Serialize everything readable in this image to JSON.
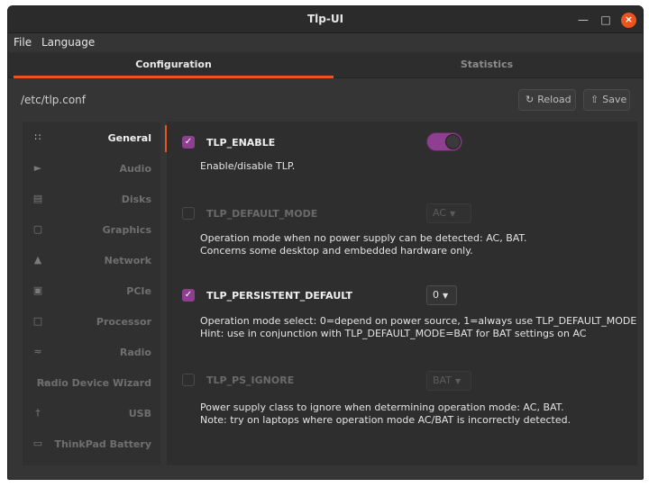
{
  "window": {
    "title": "Tlp-UI"
  },
  "menu": {
    "file": "File",
    "language": "Language"
  },
  "tabs": [
    {
      "label": "Configuration",
      "active": true
    },
    {
      "label": "Statistics",
      "active": false
    }
  ],
  "toolbar": {
    "path": "/etc/tlp.conf",
    "reload_label": "Reload",
    "save_label": "Save"
  },
  "sidebar": {
    "items": [
      {
        "label": "General",
        "icon": "grid-icon",
        "active": true
      },
      {
        "label": "Audio",
        "icon": "speaker-icon",
        "active": false
      },
      {
        "label": "Disks",
        "icon": "disk-icon",
        "active": false
      },
      {
        "label": "Graphics",
        "icon": "monitor-icon",
        "active": false
      },
      {
        "label": "Network",
        "icon": "network-icon",
        "active": false
      },
      {
        "label": "PCIe",
        "icon": "chip-icon",
        "active": false
      },
      {
        "label": "Processor",
        "icon": "processor-icon",
        "active": false
      },
      {
        "label": "Radio",
        "icon": "wifi-icon",
        "active": false
      },
      {
        "label": "Radio Device Wizard",
        "icon": "magic-icon",
        "active": false
      },
      {
        "label": "USB",
        "icon": "usb-icon",
        "active": false
      },
      {
        "label": "ThinkPad Battery",
        "icon": "battery-icon",
        "active": false
      }
    ]
  },
  "settings": {
    "tlp_enable": {
      "name": "TLP_ENABLE",
      "checked": true,
      "value": "on",
      "desc1": "Enable/disable TLP."
    },
    "tlp_default_mode": {
      "name": "TLP_DEFAULT_MODE",
      "checked": false,
      "value": "AC",
      "desc1": "Operation mode when no power supply can be detected: AC, BAT.",
      "desc2": "Concerns some desktop and embedded hardware only."
    },
    "tlp_persistent_default": {
      "name": "TLP_PERSISTENT_DEFAULT",
      "checked": true,
      "value": "0",
      "desc1": "Operation mode select: 0=depend on power source, 1=always use TLP_DEFAULT_MODE",
      "desc2": "Hint: use in conjunction with TLP_DEFAULT_MODE=BAT for BAT settings on AC"
    },
    "tlp_ps_ignore": {
      "name": "TLP_PS_IGNORE",
      "checked": false,
      "value": "BAT",
      "desc1": "Power supply class to ignore when determining operation mode: AC, BAT.",
      "desc2": "Note: try on laptops where operation mode AC/BAT is incorrectly detected."
    }
  },
  "colors": {
    "accent": "#e95420",
    "toggle": "#8f3f8f",
    "background": "#353535"
  }
}
